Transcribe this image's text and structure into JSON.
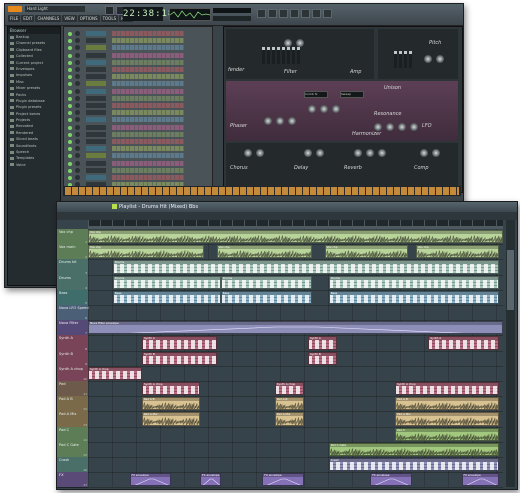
{
  "app": {
    "song_title": "Hard Light",
    "menus": [
      "FILE",
      "EDIT",
      "CHANNELS",
      "VIEW",
      "OPTIONS",
      "TOOLS",
      "HELP"
    ],
    "time": "22:38:18",
    "browser_title": "Browser"
  },
  "browser": {
    "items": [
      "Backup",
      "Channel presets",
      "Clipboard files",
      "Collected",
      "Current project",
      "Envelopes",
      "Impulses",
      "Misc",
      "Mixer presets",
      "Packs",
      "Plugin database",
      "Plugin presets",
      "Project bones",
      "Projects",
      "Recorded",
      "Rendered",
      "Sliced beats",
      "Soundfonts",
      "Speech",
      "Templates",
      "Voice"
    ]
  },
  "sytrus": {
    "labels": {
      "fender": "fender",
      "amp": "Amp",
      "filter": "Filter",
      "unison": "Unison",
      "resonance": "Resonance",
      "phaser": "Phaser",
      "lfo": "LFO",
      "harmonizer": "Harmonizer",
      "chorus": "Chorus",
      "delay": "Delay",
      "reverb": "Reverb",
      "comp": "Comp",
      "pitch": "Pitch"
    },
    "select_a": "Comb fx",
    "select_b": "Sweep"
  },
  "playlist": {
    "title": "Playlist - Drums Hit (Mixed) Bbs",
    "tracks": [
      {
        "label": "Vox chp",
        "num": "1",
        "color": "#5d7d56"
      },
      {
        "label": "Vox main",
        "num": "2",
        "color": "#5d7d56"
      },
      {
        "label": "Drums kit",
        "num": "3",
        "color": "#4a6e68"
      },
      {
        "label": "Drums",
        "num": "4",
        "color": "#4a6e68"
      },
      {
        "label": "Bass",
        "num": "5",
        "color": "#3f6d6b"
      },
      {
        "label": "Nova LFO Speed",
        "num": "6",
        "color": "#4b5f77"
      },
      {
        "label": "Nova Filter",
        "num": "7",
        "color": "#554a77"
      },
      {
        "label": "Synth A",
        "num": "8",
        "color": "#7a4458"
      },
      {
        "label": "Synth B",
        "num": "9",
        "color": "#7a4458"
      },
      {
        "label": "Synth A chop",
        "num": "10",
        "color": "#7a4458"
      },
      {
        "label": "Pad",
        "num": "11",
        "color": "#6d5a4a"
      },
      {
        "label": "Pad A B",
        "num": "12",
        "color": "#7a6a4a"
      },
      {
        "label": "Pad A Mix",
        "num": "13",
        "color": "#7a6a4a"
      },
      {
        "label": "Pad C",
        "num": "14",
        "color": "#5d7d56"
      },
      {
        "label": "Pad C Gate",
        "num": "15",
        "color": "#5d7d56"
      },
      {
        "label": "Crash",
        "num": "16",
        "color": "#4a6e68"
      },
      {
        "label": "FX",
        "num": "17",
        "color": "#5a4a77"
      }
    ],
    "clip_labels": {
      "vox": "Vox chp",
      "drums": "Drums",
      "bass": "Bass",
      "nova": "Nova LFO Speed",
      "novaf": "Nova Filter envelope",
      "synthA": "Synth A",
      "synthB": "Synth B",
      "chop": "Synth A chop",
      "padAB": "Pad A B",
      "padMix": "Pad A Mix",
      "padC": "Pad C",
      "padCG": "Pad C Gate",
      "crash": "Crash",
      "fx": "FX envelope"
    }
  },
  "colors": {
    "accent": "#b7e04a",
    "vox": "#b8d49a",
    "drums": "#a7c9bd",
    "bass": "#86b1c7",
    "nova": "#8e8fb9",
    "synth": "#b66a82",
    "pad": "#d8c291",
    "padgreen": "#a2c77e",
    "fx": "#8471b6"
  }
}
